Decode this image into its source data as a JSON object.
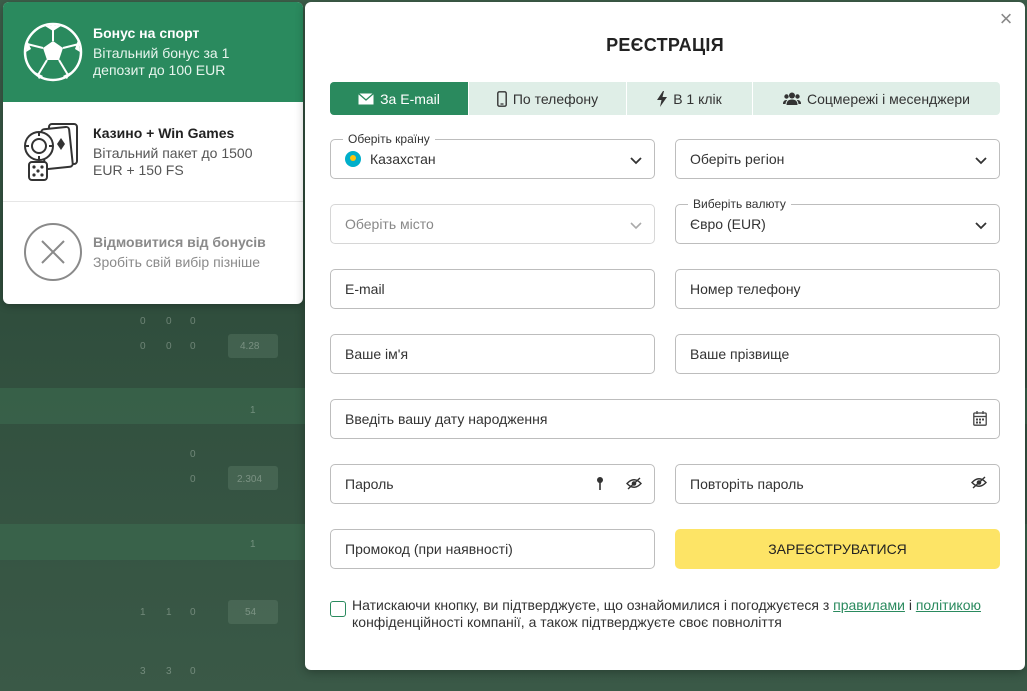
{
  "bonuses": {
    "sport": {
      "title": "Бонус на спорт",
      "desc": "Вітальний бонус за 1 депозит до 100 EUR"
    },
    "casino": {
      "title": "Казино + Win Games",
      "desc": "Вітальний пакет до 1500 EUR + 150 FS"
    },
    "decline": {
      "title": "Відмовитися від бонусів",
      "desc": "Зробіть свій вибір пізніше"
    }
  },
  "modal": {
    "title": "РЕЄСТРАЦІЯ",
    "close": "×",
    "tabs": [
      {
        "label": "За E-mail",
        "icon": "envelope-icon"
      },
      {
        "label": "По телефону",
        "icon": "phone-icon"
      },
      {
        "label": "В 1 клік",
        "icon": "lightning-icon"
      },
      {
        "label": "Соцмережі і месенджери",
        "icon": "users-icon"
      }
    ],
    "country": {
      "label": "Оберіть країну",
      "value": "Казахстан"
    },
    "region": {
      "placeholder": "Оберіть регіон"
    },
    "city": {
      "placeholder": "Оберіть місто"
    },
    "currency": {
      "label": "Виберіть валюту",
      "value": "Євро (EUR)"
    },
    "email": {
      "placeholder": "E-mail"
    },
    "phone": {
      "placeholder": "Номер телефону"
    },
    "first_name": {
      "placeholder": "Ваше ім'я"
    },
    "last_name": {
      "placeholder": "Ваше прізвище"
    },
    "birthdate": {
      "placeholder": "Введіть вашу дату народження"
    },
    "password": {
      "placeholder": "Пароль"
    },
    "password_repeat": {
      "placeholder": "Повторіть пароль"
    },
    "promo": {
      "placeholder": "Промокод (при наявності)"
    },
    "submit": "ЗАРЕЄСТРУВАТИСЯ",
    "consent": {
      "part1": "Натискаючи кнопку, ви підтверджуєте, що ознайомилися і погоджуєтеся з ",
      "link1": "правилами",
      "part2": " і ",
      "link2": "політикою",
      "part3": " конфіденційності компанії, а також підтверджуєте своє повноліття"
    }
  },
  "background": {
    "cells": [
      "0",
      "0",
      "0",
      "0",
      "0",
      "0",
      "4.28",
      "1",
      "0",
      "0",
      "2.304",
      "1",
      "1",
      "1",
      "0",
      "54",
      "3",
      "3",
      "0"
    ]
  },
  "colors": {
    "brand": "#2a8a5e",
    "submit": "#fde466",
    "tab_bg": "#dfeee7"
  }
}
